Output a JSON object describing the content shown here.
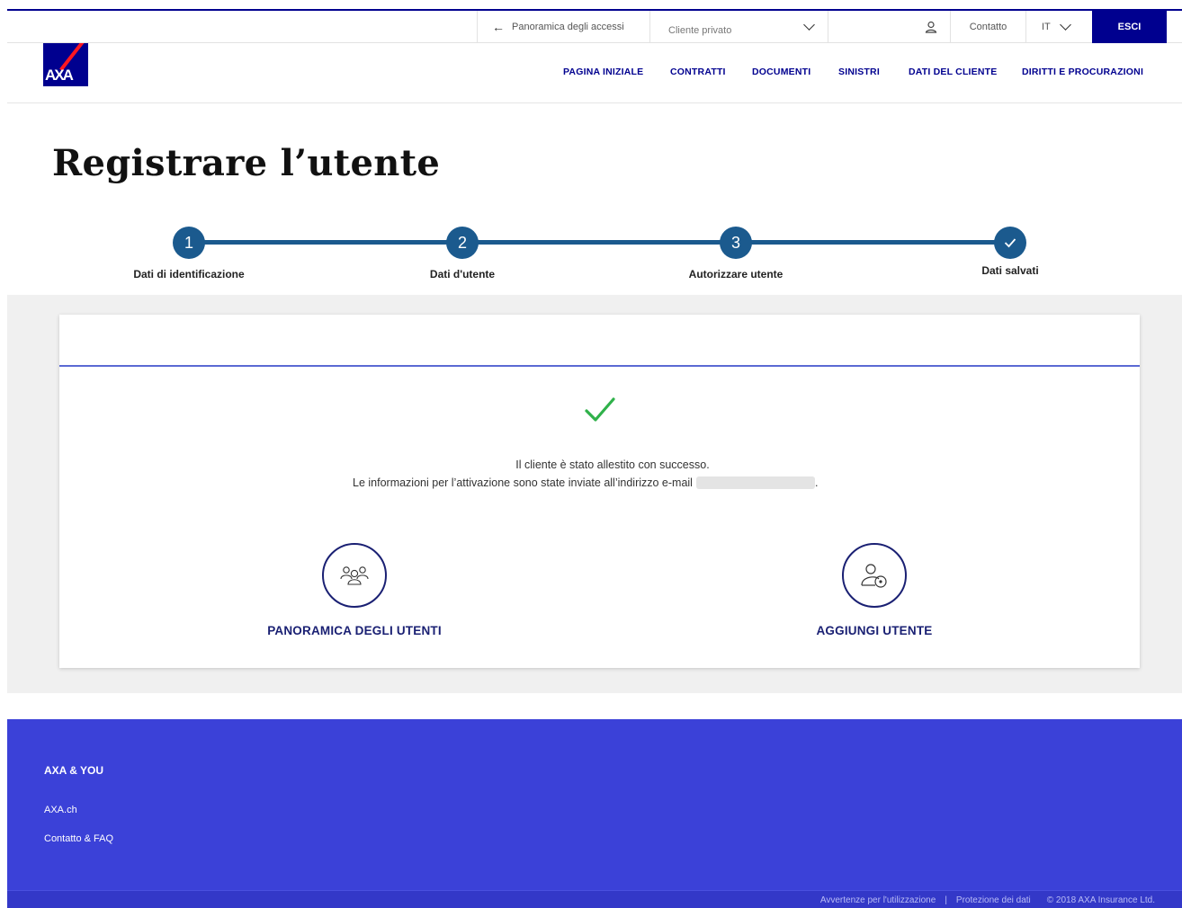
{
  "utility_bar": {
    "back_label": "Panoramica degli accessi",
    "profile_value": "Cliente privato",
    "contact_label": "Contatto",
    "language_value": "IT",
    "exit_label": "ESCI"
  },
  "logo": {
    "text": "AXA"
  },
  "nav": {
    "items": [
      "PAGINA INIZIALE",
      "CONTRATTI",
      "DOCUMENTI",
      "SINISTRI",
      "DATI DEL CLIENTE",
      "DIRITTI E PROCURAZIONI"
    ]
  },
  "page_title": "Registrare l’utente",
  "stepper": {
    "steps": [
      {
        "number": "1",
        "label": "Dati di identificazione"
      },
      {
        "number": "2",
        "label": "Dati d'utente"
      },
      {
        "number": "3",
        "label": "Autorizzare utente"
      },
      {
        "number": "✓",
        "label": "Dati salvati"
      }
    ]
  },
  "confirmation": {
    "line1": "Il cliente è stato allestito con successo.",
    "line2": "Le informazioni per l’attivazione sono state inviate all’indirizzo e-mail",
    "line2_end": "."
  },
  "actions": {
    "users_overview_label": "PANORAMICA DEGLI UTENTI",
    "add_user_label": "AGGIUNGI UTENTE"
  },
  "footer": {
    "section_title": "AXA & YOU",
    "links": [
      "AXA.ch",
      "Contatto & FAQ"
    ],
    "legal": {
      "terms": "Avvertenze per l'utilizzazione",
      "privacy": "Protezione dei dati",
      "copyright": "© 2018 AXA Insurance Ltd."
    }
  },
  "colors": {
    "brand_blue": "#00008f",
    "step_blue": "#1b5a8e",
    "success_green": "#2fb14a",
    "footer_blue": "#3b41d8"
  }
}
